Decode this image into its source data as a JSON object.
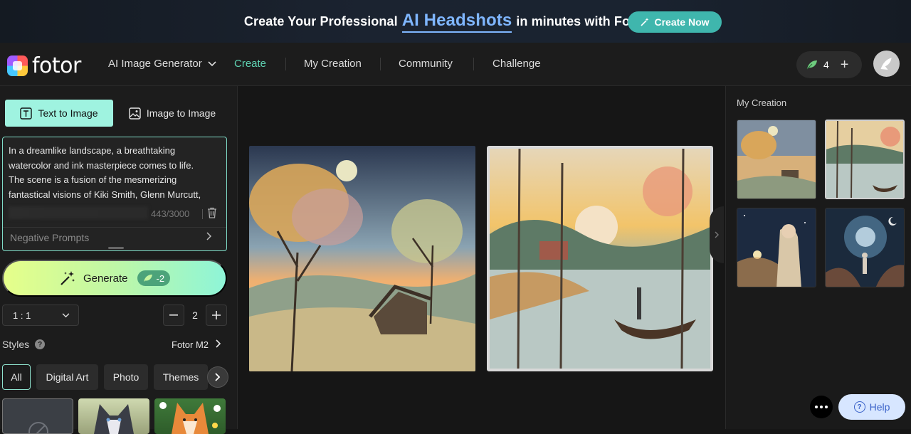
{
  "banner": {
    "text_before": "Create Your Professional",
    "accent": "AI Headshots",
    "text_after": "in minutes with Fotor AI.",
    "cta_label": "Create Now"
  },
  "nav": {
    "logo_text": "fotor",
    "generator_label": "AI Image Generator",
    "items": [
      {
        "label": "Create",
        "active": true
      },
      {
        "label": "My Creation",
        "active": false
      },
      {
        "label": "Community",
        "active": false
      },
      {
        "label": "Challenge",
        "active": false
      }
    ],
    "credits": "4",
    "accent_color": "#5fd3b3"
  },
  "left": {
    "tabs": {
      "text_to_image": "Text to Image",
      "image_to_image": "Image to Image"
    },
    "prompt": {
      "lines": [
        "In a dreamlike landscape, a breathtaking",
        "watercolor and ink masterpiece comes to life.",
        "The scene is a fusion of the mesmerizing",
        "fantastical visions of Kiki Smith, Glenn Murcutt,"
      ],
      "counter": "443/3000"
    },
    "negative_prompts_label": "Negative Prompts",
    "generate": {
      "label": "Generate",
      "cost": "-2"
    },
    "ratio": "1 : 1",
    "count": "2",
    "styles_label": "Styles",
    "model": "Fotor M2",
    "style_chips": [
      "All",
      "Digital Art",
      "Photo",
      "Themes"
    ]
  },
  "right": {
    "title": "My Creation"
  },
  "help": {
    "label": "Help"
  }
}
